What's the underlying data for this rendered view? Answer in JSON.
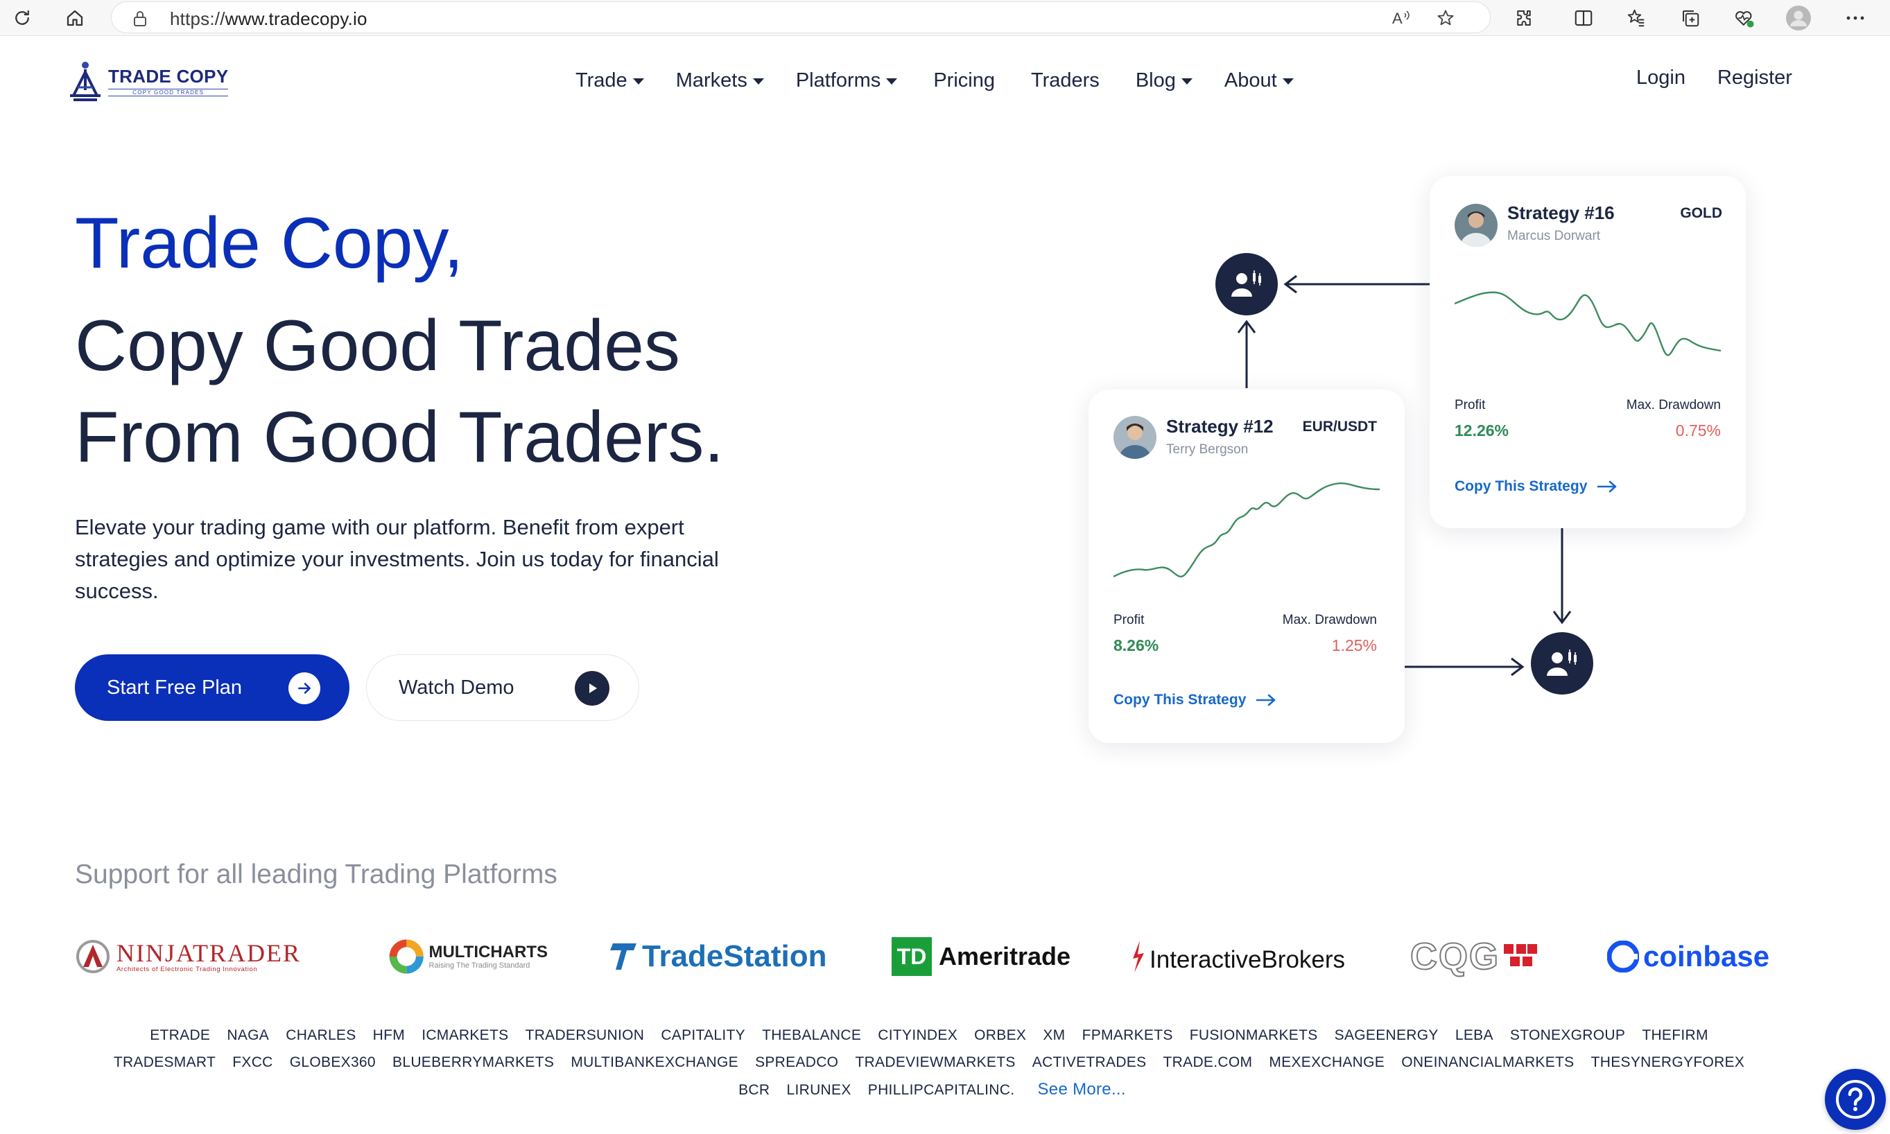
{
  "browser": {
    "url_scheme": "https://",
    "url_host": "www.tradecopy.io",
    "profile_icon": "avatar-icon"
  },
  "brand": {
    "name": "TRADE COPY",
    "tagline": "COPY GOOD TRADES"
  },
  "nav": {
    "items": [
      {
        "label": "Trade",
        "dropdown": true
      },
      {
        "label": "Markets",
        "dropdown": true
      },
      {
        "label": "Platforms",
        "dropdown": true
      },
      {
        "label": "Pricing",
        "dropdown": false
      },
      {
        "label": "Traders",
        "dropdown": false
      },
      {
        "label": "Blog",
        "dropdown": true
      },
      {
        "label": "About",
        "dropdown": true
      }
    ],
    "login": "Login",
    "register": "Register"
  },
  "hero": {
    "headline_1": "Trade Copy,",
    "headline_2": "Copy Good Trades",
    "headline_3": "From Good Traders.",
    "lead": "Elevate your trading game with our platform. Benefit from expert strategies and optimize your investments. Join us today for financial success.",
    "primary_cta": "Start Free Plan",
    "secondary_cta": "Watch Demo"
  },
  "cards": [
    {
      "title": "Strategy #16",
      "trader": "Marcus Dorwart",
      "pair": "GOLD",
      "profit_label": "Profit",
      "profit": "12.26%",
      "drawdown_label": "Max. Drawdown",
      "drawdown": "0.75%",
      "cta": "Copy This Strategy"
    },
    {
      "title": "Strategy #12",
      "trader": "Terry Bergson",
      "pair": "EUR/USDT",
      "profit_label": "Profit",
      "profit": "8.26%",
      "drawdown_label": "Max. Drawdown",
      "drawdown": "1.25%",
      "cta": "Copy This Strategy"
    }
  ],
  "colors": {
    "brand_blue": "#0a2fb8",
    "navy": "#1c2541",
    "profit_green": "#2e8b57",
    "drawdown_red": "#e35d5d",
    "link_blue": "#1769c9"
  },
  "platforms": {
    "heading": "Support for all leading Trading Platforms",
    "logos": [
      {
        "name": "NINJATRADER",
        "sub": "Architects of Electronic Trading Innovation"
      },
      {
        "name": "MULTICHARTS",
        "sub": "Raising The Trading Standard"
      },
      {
        "name": "TradeStation"
      },
      {
        "name": "Ameritrade",
        "badge": "TD"
      },
      {
        "name": "InteractiveBrokers"
      },
      {
        "name": "CQG"
      },
      {
        "name": "coinbase"
      }
    ],
    "brokers": [
      "ETRADE",
      "NAGA",
      "CHARLES",
      "HFM",
      "ICMARKETS",
      "TRADERSUNION",
      "CAPITALITY",
      "THEBALANCE",
      "CITYINDEX",
      "ORBEX",
      "XM",
      "FPMARKETS",
      "FUSIONMARKETS",
      "SAGEENERGY",
      "LEBA",
      "STONEXGROUP",
      "THEFIRM",
      "TRADESMART",
      "FXCC",
      "GLOBEX360",
      "BLUEBERRYMARKETS",
      "MULTIBANKEXCHANGE",
      "SPREADCO",
      "TRADEVIEWMARKETS",
      "ACTIVETRADES",
      "TRADE.COM",
      "MEXEXCHANGE",
      "ONEINANCIALMARKETS",
      "THESYNERGYFOREX",
      "BCR",
      "LIRUNEX",
      "PHILLIPCAPITALINC."
    ],
    "see_more": "See More..."
  }
}
